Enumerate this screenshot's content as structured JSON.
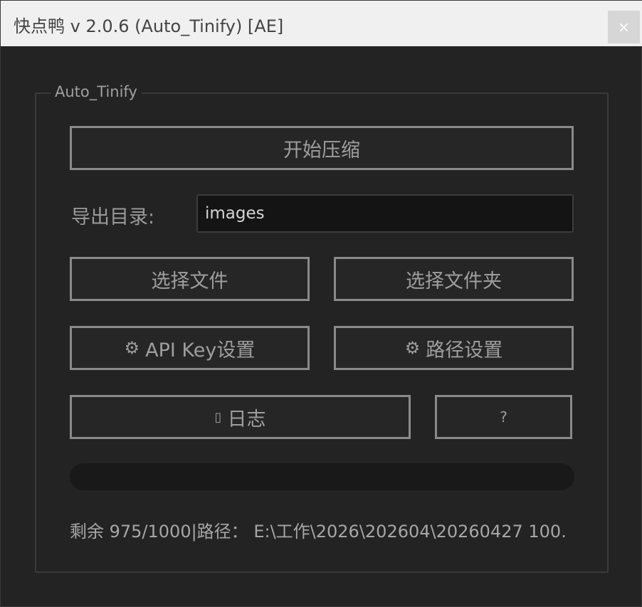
{
  "window": {
    "title": "快点鸭 v 2.0.6 (Auto_Tinify) [AE]",
    "close_label": "×"
  },
  "group": {
    "label": "Auto_Tinify"
  },
  "buttons": {
    "start": "开始压缩",
    "select_files": "选择文件",
    "select_folder": "选择文件夹",
    "api_key_icon": "⚙",
    "api_key": "API Key设置",
    "path_settings_icon": "⚙",
    "path_settings": "路径设置",
    "log_icon": "▯",
    "log": "日志",
    "help": "?"
  },
  "export_dir": {
    "label": "导出目录:",
    "value": "images"
  },
  "progress": {
    "value": 0
  },
  "status": {
    "text": "剩余 975/1000|路径： E:\\工作\\2026\\202604\\20260427 100."
  },
  "icons": {
    "gear": "gear-icon",
    "log": "log-icon"
  }
}
